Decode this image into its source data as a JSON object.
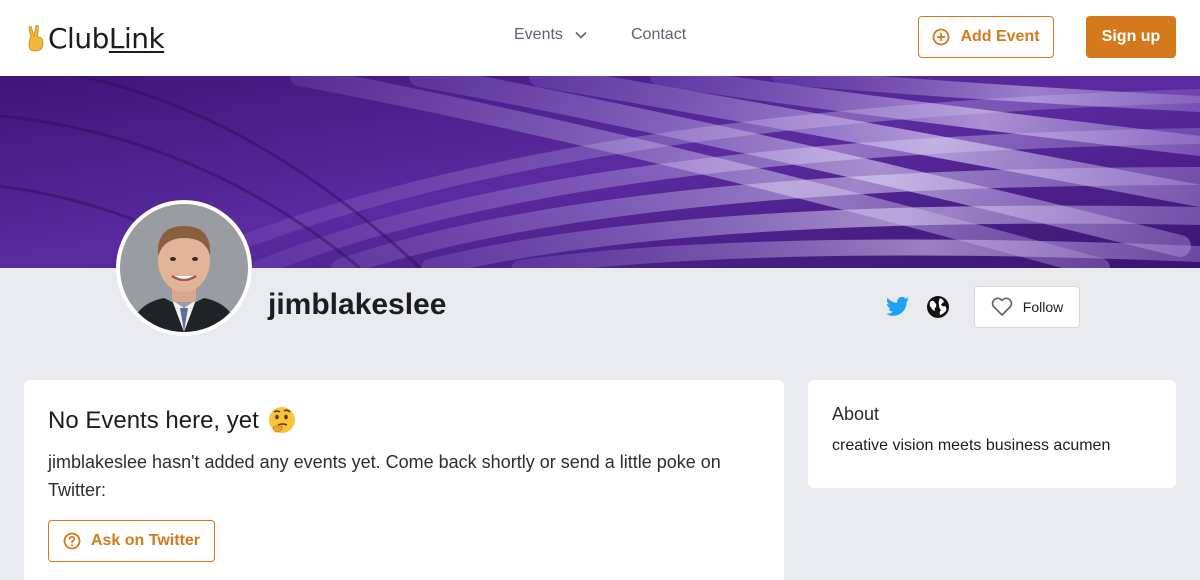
{
  "header": {
    "logo_club": "Club",
    "logo_link": "Link",
    "nav_events": "Events",
    "nav_contact": "Contact",
    "add_event": "Add Event",
    "sign_up": "Sign up"
  },
  "profile": {
    "username": "jimblakeslee",
    "follow": "Follow"
  },
  "events_card": {
    "title": "No Events here, yet",
    "message": "jimblakeslee hasn't added any events yet. Come back shortly or send a little poke on Twitter:",
    "ask_button": "Ask on Twitter"
  },
  "about_card": {
    "title": "About",
    "text": "creative vision meets business acumen"
  },
  "colors": {
    "accent": "#d47a1c",
    "twitter": "#1da1f2",
    "banner": "#4a1f8c"
  }
}
